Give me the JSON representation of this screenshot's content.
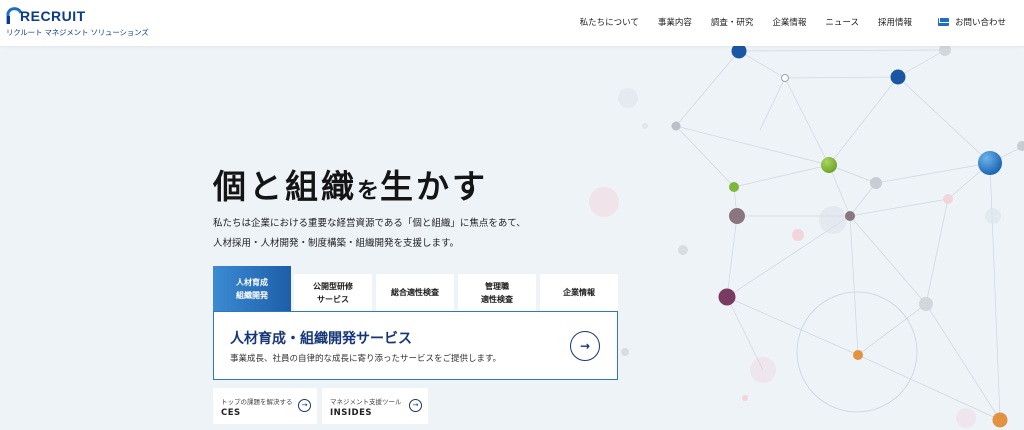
{
  "header": {
    "logo_word": "RECRUIT",
    "logo_sub": "リクルート マネジメント ソリューションズ",
    "nav": [
      "私たちについて",
      "事業内容",
      "調査・研究",
      "企業情報",
      "ニュース",
      "採用情報"
    ],
    "contact_label": "お問い合わせ",
    "contact_icon": "mail-icon",
    "accent": "#1d6fc4"
  },
  "hero": {
    "title_a": "個と組織",
    "title_b": "を",
    "title_c": "生かす",
    "desc_line1": "私たちは企業における重要な経営資源である「個と組織」に焦点をあて、",
    "desc_line2": "人材採用・人材開発・制度構築・組織開発を支援します。"
  },
  "tabs": [
    {
      "line1": "人材育成",
      "line2": "組織開発",
      "active": true
    },
    {
      "line1": "公開型研修",
      "line2": "サービス",
      "active": false
    },
    {
      "line1": "総合適性検査",
      "line2": "",
      "active": false
    },
    {
      "line1": "管理職",
      "line2": "適性検査",
      "active": false
    },
    {
      "line1": "企業情報",
      "line2": "",
      "active": false
    }
  ],
  "panel": {
    "title": "人材育成・組織開発サービス",
    "desc": "事業成長、社員の自律的な成長に寄り添ったサービスをご提供します。",
    "arrow": "→",
    "title_color": "#16367a"
  },
  "cards": [
    {
      "sub": "トップの課題を解決する",
      "main": "CES",
      "arrow": "→"
    },
    {
      "sub": "マネジメント支援ツール",
      "main": "INSIDES",
      "arrow": "→"
    }
  ]
}
